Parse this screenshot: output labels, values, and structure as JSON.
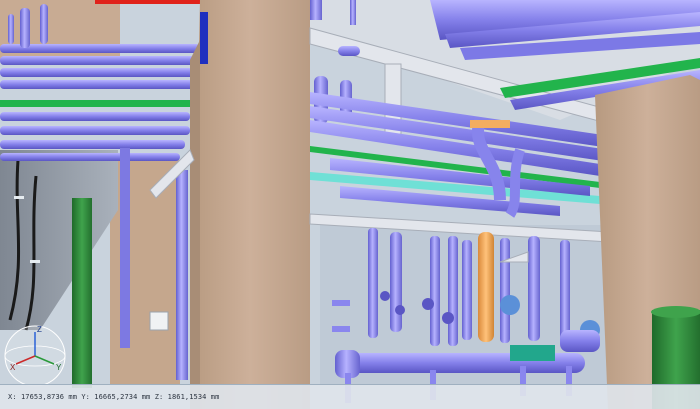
{
  "viewport": {
    "coordinates": "X: 17653,8736 mm  Y: 16665,2734 mm  Z: 1861,1534 mm"
  },
  "gizmo": {
    "x_label": "X",
    "y_label": "Y",
    "z_label": "Z"
  },
  "colors": {
    "pipe_purple": "#8a86ee",
    "pipe_highlight": "#b8b4ff",
    "pipe_green": "#27b54a",
    "pipe_cyan": "#6fe0d6",
    "pipe_orange": "#f3ad60",
    "pipe_red": "#e0221a",
    "column_tan": "#c7a98f",
    "steel_white": "#e3e6ec",
    "panel_blue": "#1e2fbf",
    "tank_green": "#2f8a3b",
    "background": "#c9d3dd"
  }
}
